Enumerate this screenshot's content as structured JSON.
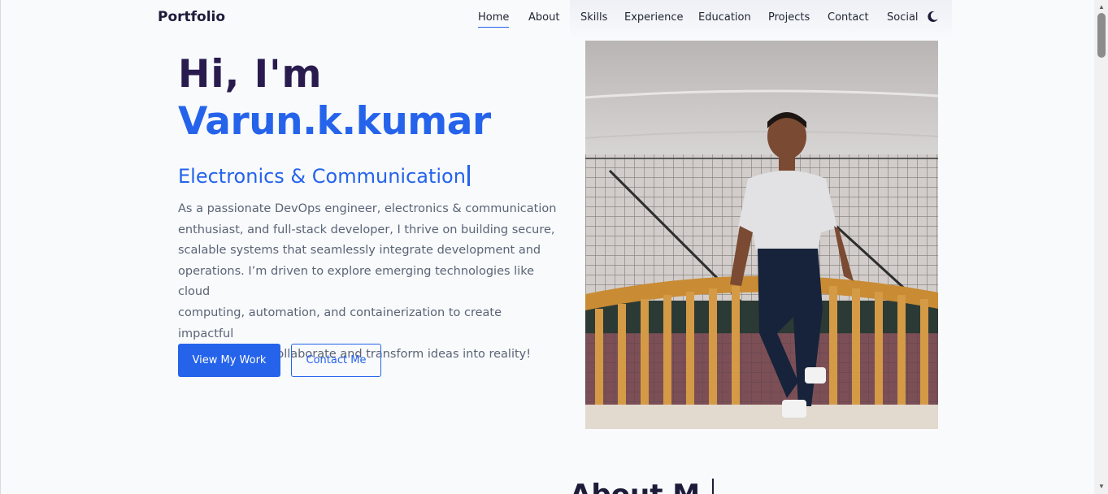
{
  "nav": {
    "brand": "Portfolio",
    "links": [
      "Home",
      "About",
      "Skills",
      "Experience",
      "Education",
      "Projects",
      "Contact",
      "Social"
    ],
    "active": "Home",
    "theme_toggle_icon": "moon-icon"
  },
  "hero": {
    "greeting": "Hi, I'm",
    "name": "Varun.k.kumar",
    "role": "Electronics & Communication",
    "description_lines": [
      "As a passionate DevOps engineer, electronics & communication",
      "enthusiast, and full-stack developer, I thrive on building secure,",
      "scalable systems that seamlessly integrate development and",
      "operations. I’m driven to explore emerging technologies like cloud",
      "computing, automation, and containerization to create impactful",
      "solutions. Let’s collaborate and transform ideas into reality!"
    ],
    "primary_button": "View My Work",
    "secondary_button": "Contact Me"
  },
  "about": {
    "heading": "About M"
  },
  "colors": {
    "accent": "#2563eb",
    "heading": "#2a1b4f",
    "background": "#f8fafc",
    "text_muted": "#5b6475"
  }
}
